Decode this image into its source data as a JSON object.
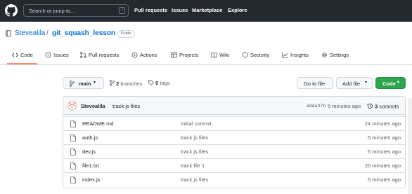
{
  "header": {
    "search_placeholder": "Search or jump to...",
    "search_shortcut": "/",
    "nav": [
      "Pull requests",
      "Issues",
      "Marketplace",
      "Explore"
    ]
  },
  "repo": {
    "owner": "Stevealila",
    "separator": "/",
    "name": "git_squash_lesson",
    "visibility": "Public"
  },
  "tabs": [
    {
      "label": "Code",
      "icon": "code-icon"
    },
    {
      "label": "Issues",
      "icon": "issue-icon"
    },
    {
      "label": "Pull requests",
      "icon": "pull-request-icon"
    },
    {
      "label": "Actions",
      "icon": "play-icon"
    },
    {
      "label": "Projects",
      "icon": "table-icon"
    },
    {
      "label": "Wiki",
      "icon": "book-icon"
    },
    {
      "label": "Security",
      "icon": "shield-icon"
    },
    {
      "label": "Insights",
      "icon": "graph-icon"
    },
    {
      "label": "Settings",
      "icon": "gear-icon"
    }
  ],
  "toolbar": {
    "branch": "main",
    "branches_count": "2",
    "branches_label": "branches",
    "tags_count": "0",
    "tags_label": "tags",
    "go_to_file": "Go to file",
    "add_file": "Add file",
    "code": "Code"
  },
  "latest_commit": {
    "author": "Stevealila",
    "message": "track js files",
    "sha": "ddda37b",
    "time": "5 minutes ago",
    "count": "3",
    "count_label": "commits"
  },
  "files": [
    {
      "name": "README.md",
      "message": "Initial commit",
      "time": "24 minutes ago"
    },
    {
      "name": "auth.js",
      "message": "track js files",
      "time": "5 minutes ago"
    },
    {
      "name": "dev.js",
      "message": "track js files",
      "time": "5 minutes ago"
    },
    {
      "name": "file1.txt",
      "message": "track file 1",
      "time": "20 minutes ago"
    },
    {
      "name": "index.js",
      "message": "track js files",
      "time": "5 minutes ago"
    }
  ],
  "colors": {
    "header_bg": "#24292f",
    "link": "#0969da",
    "tab_underline": "#fd8c73",
    "primary_button": "#2da44e"
  }
}
